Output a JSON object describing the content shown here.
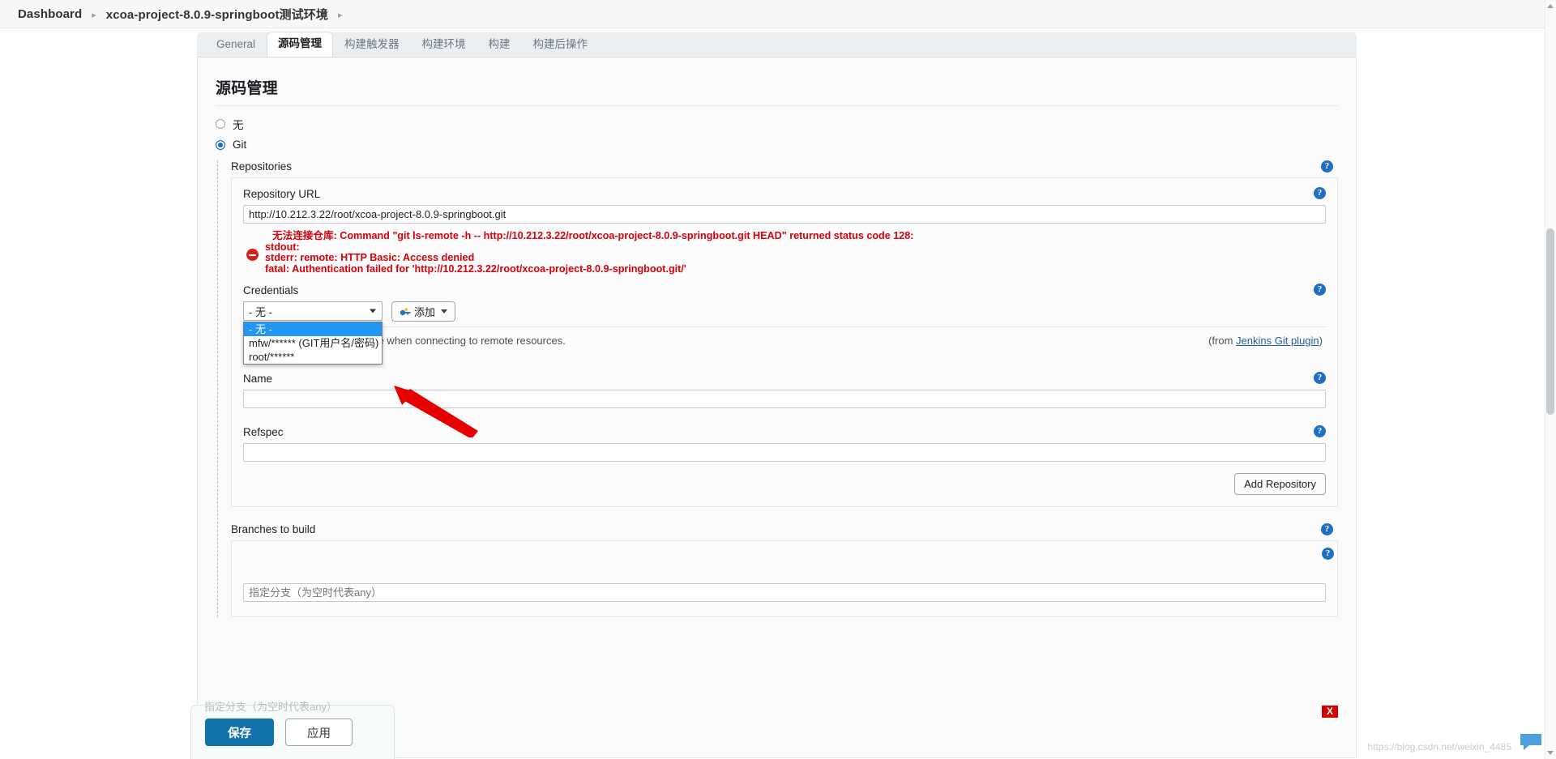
{
  "breadcrumb": {
    "items": [
      {
        "label": "Dashboard"
      },
      {
        "label": "xcoa-project-8.0.9-springboot测试环境"
      }
    ],
    "separator": "▸"
  },
  "tabs": [
    {
      "label": "General",
      "active": false
    },
    {
      "label": "源码管理",
      "active": true
    },
    {
      "label": "构建触发器",
      "active": false
    },
    {
      "label": "构建环境",
      "active": false
    },
    {
      "label": "构建",
      "active": false
    },
    {
      "label": "构建后操作",
      "active": false
    }
  ],
  "section": {
    "title": "源码管理",
    "scm_options": [
      {
        "label": "无",
        "checked": false
      },
      {
        "label": "Git",
        "checked": true
      }
    ]
  },
  "repositories": {
    "label": "Repositories",
    "repository_url": {
      "label": "Repository URL",
      "value": "http://10.212.3.22/root/xcoa-project-8.0.9-springboot.git"
    },
    "error": {
      "line1": "无法连接仓库:  Command \"git ls-remote -h -- http://10.212.3.22/root/xcoa-project-8.0.9-springboot.git HEAD\" returned status code 128:",
      "line2": "stdout:",
      "line3": "stderr: remote: HTTP Basic: Access denied",
      "line4": "fatal: Authentication failed for 'http://10.212.3.22/root/xcoa-project-8.0.9-springboot.git/'"
    },
    "credentials": {
      "label": "Credentials",
      "selected": "- 无 -",
      "options": [
        {
          "label": "- 无 -",
          "selected": true
        },
        {
          "label": "mfw/****** (GIT用户名/密码)",
          "selected": false
        },
        {
          "label": "root/******",
          "selected": false
        }
      ],
      "add_button": "添加",
      "help_text": "Specify the credentials to use when connecting to remote resources.",
      "help_from_prefix": "(from ",
      "help_from_link": "Jenkins Git plugin",
      "help_from_suffix": ")"
    },
    "name": {
      "label": "Name",
      "value": ""
    },
    "refspec": {
      "label": "Refspec",
      "value": ""
    },
    "add_repository_button": "Add Repository"
  },
  "branches": {
    "label": "Branches to build",
    "branch_specifier_placeholder": "指定分支（为空时代表any）",
    "value": ""
  },
  "footer": {
    "save_label": "保存",
    "apply_label": "应用"
  },
  "annotations": {
    "x_badge": "X",
    "watermark": "https://blog.csdn.net/weixin_4485"
  },
  "icons": {
    "help": "?"
  }
}
